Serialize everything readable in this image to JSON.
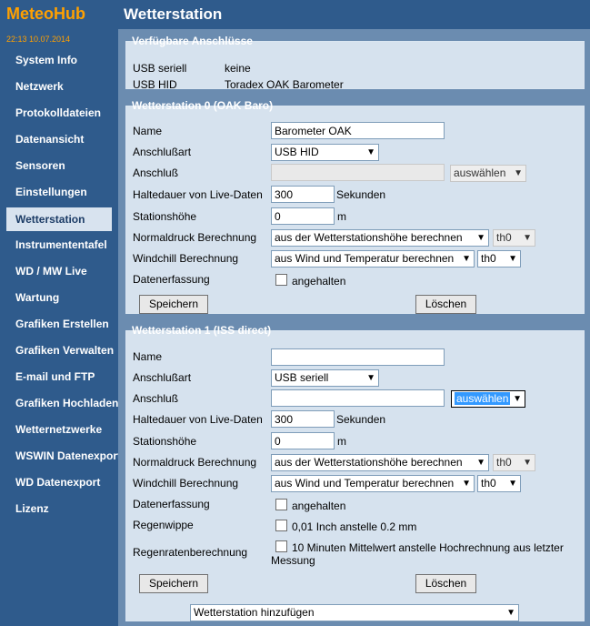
{
  "app": {
    "brand": "MeteoHub",
    "clock": "22:13  10.07.2014",
    "page_title": "Wetterstation"
  },
  "nav": [
    "System Info",
    "Netzwerk",
    "Protokolldateien",
    "Datenansicht",
    "Sensoren",
    "Einstellungen",
    "Wetterstation",
    "Instrumententafel",
    "WD / MW Live",
    "Wartung",
    "Grafiken Erstellen",
    "Grafiken Verwalten",
    "E-mail und FTP",
    "Grafiken Hochladen",
    "Wetternetzwerke",
    "WSWIN Datenexport",
    "WD Datenexport",
    "Lizenz"
  ],
  "available": {
    "legend": "Verfügbare Anschlüsse",
    "rows": [
      {
        "label": "USB seriell",
        "value": "keine"
      },
      {
        "label": "USB HID",
        "value": "Toradex OAK Barometer"
      }
    ]
  },
  "labels": {
    "name": "Name",
    "type": "Anschlußart",
    "port": "Anschluß",
    "hold": "Haltedauer von Live-Daten",
    "height": "Stationshöhe",
    "pressure": "Normaldruck Berechnung",
    "windchill": "Windchill Berechnung",
    "capture": "Datenerfassung",
    "rain": "Regenwippe",
    "rainrate": "Regenratenberechnung",
    "seconds": "Sekunden",
    "meters": "m",
    "paused": "angehalten",
    "rain_opt": "0,01 Inch anstelle 0.2 mm",
    "rainrate_opt1": "10 Minuten Mittelwert anstelle Hochrechnung aus letzter",
    "rainrate_opt2": "Messung",
    "select": "auswählen",
    "save": "Speichern",
    "delete": "Löschen"
  },
  "station0": {
    "legend": "Wetterstation 0 (OAK Baro)",
    "name": "Barometer OAK",
    "type": "USB HID",
    "port": "",
    "hold": "300",
    "height": "0",
    "pressure": "aus der Wetterstationshöhe berechnen",
    "pressure_sensor": "th0",
    "windchill": "aus Wind und Temperatur berechnen",
    "windchill_sensor": "th0"
  },
  "station1": {
    "legend": "Wetterstation 1 (ISS direct)",
    "name": "",
    "type": "USB seriell",
    "port": "",
    "hold": "300",
    "height": "0",
    "pressure": "aus der Wetterstationshöhe berechnen",
    "pressure_sensor": "th0",
    "windchill": "aus Wind und Temperatur berechnen",
    "windchill_sensor": "th0"
  },
  "add_station": "Wetterstation hinzufügen",
  "colors": {
    "sidebar": "#2f5b8c",
    "brand": "#ffa000",
    "panel": "#d6e2ee",
    "content_bg": "#6b8cb0"
  }
}
